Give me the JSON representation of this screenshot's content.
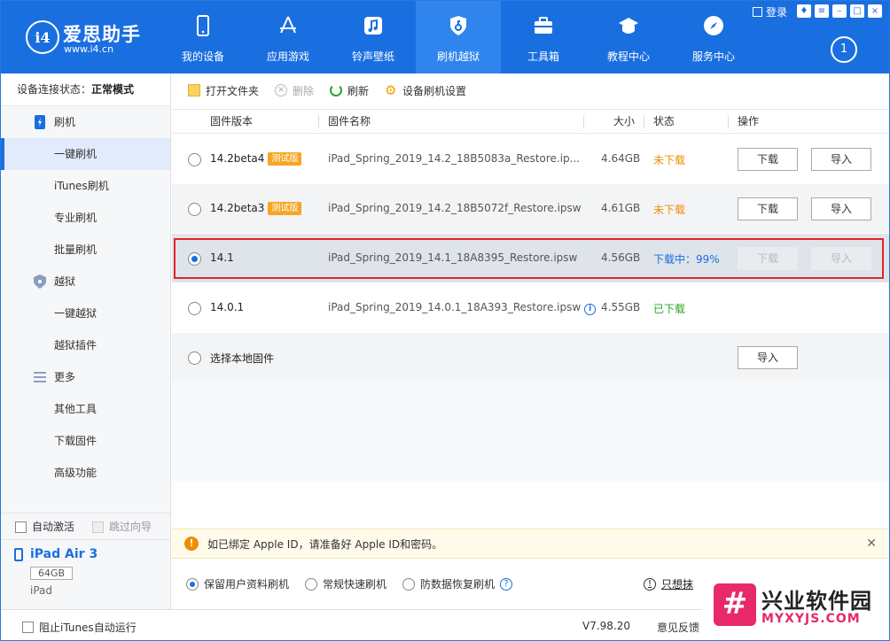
{
  "brand": {
    "name": "爱思助手",
    "url": "www.i4.cn",
    "mark": "i4"
  },
  "nav": [
    {
      "label": "我的设备",
      "icon": "phone-icon"
    },
    {
      "label": "应用游戏",
      "icon": "appstore-icon"
    },
    {
      "label": "铃声壁纸",
      "icon": "music-icon"
    },
    {
      "label": "刷机越狱",
      "icon": "shield-key-icon"
    },
    {
      "label": "工具箱",
      "icon": "toolbox-icon"
    },
    {
      "label": "教程中心",
      "icon": "graduation-cap-icon"
    },
    {
      "label": "服务中心",
      "icon": "compass-icon"
    }
  ],
  "window": {
    "login": "登录",
    "badge": "1"
  },
  "sidebar": {
    "status_label": "设备连接状态：",
    "status_value": "正常模式",
    "groups": [
      {
        "label": "刷机",
        "items": [
          "一键刷机",
          "iTunes刷机",
          "专业刷机",
          "批量刷机"
        ]
      },
      {
        "label": "越狱",
        "items": [
          "一键越狱",
          "越狱插件"
        ]
      },
      {
        "label": "更多",
        "items": [
          "其他工具",
          "下载固件",
          "高级功能"
        ]
      }
    ],
    "auto_activate": "自动激活",
    "skip_guide": "跳过向导",
    "device": {
      "name": "iPad Air 3",
      "capacity": "64GB",
      "type": "iPad"
    }
  },
  "toolbar": {
    "open_folder": "打开文件夹",
    "delete": "删除",
    "refresh": "刷新",
    "settings": "设备刷机设置"
  },
  "table": {
    "headers": {
      "version": "固件版本",
      "name": "固件名称",
      "size": "大小",
      "status": "状态",
      "action": "操作"
    },
    "rows": [
      {
        "version": "14.2beta4",
        "tag": "测试版",
        "name": "iPad_Spring_2019_14.2_18B5083a_Restore.ip...",
        "size": "4.64GB",
        "status": "未下载",
        "download": "下载",
        "import": "导入"
      },
      {
        "version": "14.2beta3",
        "tag": "测试版",
        "name": "iPad_Spring_2019_14.2_18B5072f_Restore.ipsw",
        "size": "4.61GB",
        "status": "未下载",
        "download": "下载",
        "import": "导入"
      },
      {
        "version": "14.1",
        "name": "iPad_Spring_2019_14.1_18A8395_Restore.ipsw",
        "size": "4.56GB",
        "status": "下载中：99%",
        "download": "下载",
        "import": "导入"
      },
      {
        "version": "14.0.1",
        "name": "iPad_Spring_2019_14.0.1_18A393_Restore.ipsw",
        "size": "4.55GB",
        "status": "已下载"
      },
      {
        "version": "选择本地固件",
        "import": "导入"
      }
    ]
  },
  "notice": {
    "text": "如已绑定 Apple ID，请准备好 Apple ID和密码。"
  },
  "modes": {
    "keep": "保留用户资料刷机",
    "quick": "常规快速刷机",
    "recover": "防数据恢复刷机",
    "erase": "只想抹"
  },
  "footer": {
    "block_itunes": "阻止iTunes自动运行",
    "version": "V7.98.20",
    "feedback": "意见反馈"
  },
  "watermark": {
    "name": "兴业软件园",
    "url": "MYXYJS.COM",
    "mark": "#"
  },
  "colors": {
    "header": "#1a6fe0",
    "highlight": "#e0262c",
    "beta": "#f5a623"
  }
}
